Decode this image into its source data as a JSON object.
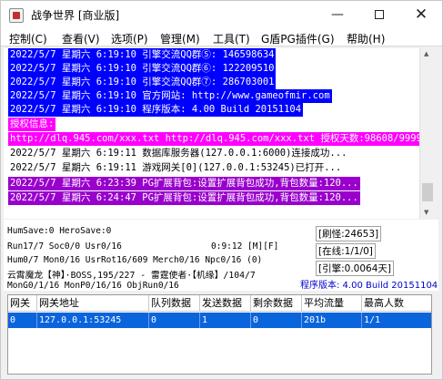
{
  "window": {
    "title": "战争世界 [商业版]",
    "controls": {
      "minimize": "—",
      "close": "✕"
    }
  },
  "menu": [
    "控制(C)",
    "查看(V)",
    "选项(P)",
    "管理(M)",
    "工具(T)",
    "G盾PG插件(G)",
    "帮助(H)"
  ],
  "colors": {
    "blue_bg": "#0000ff",
    "magenta_bg": "#ff00ff",
    "purple_bg": "#9900cc",
    "selected_row": "#0a64dc"
  },
  "log": [
    {
      "text": "2022/5/7 星期六 6:19:10 引擎交流QQ群⑤: 146598634",
      "style": "blue"
    },
    {
      "text": "2022/5/7 星期六 6:19:10 引擎交流QQ群⑥: 122209510",
      "style": "blue"
    },
    {
      "text": "2022/5/7 星期六 6:19:10 引擎交流QQ群⑦: 286703001",
      "style": "blue"
    },
    {
      "text": "2022/5/7 星期六 6:19:10 官方网站: http://www.gameofmir.com",
      "style": "blue"
    },
    {
      "text": "2022/5/7 星期六 6:19:10 程序版本: 4.00 Build 20151104",
      "style": "blue"
    },
    {
      "text": "授权信息:",
      "style": "magenta"
    },
    {
      "text": "http://dlq.945.com/xxx.txt http://dlq.945.com/xxx.txt 授权天数:98608/99999",
      "style": "magenta"
    },
    {
      "text": "2022/5/7 星期六 6:19:11 数据库服务器(127.0.0.1:6000)连接成功...",
      "style": "plain"
    },
    {
      "text": "2022/5/7 星期六 6:19:11 游戏网关[0](127.0.0.1:53245)已打开...",
      "style": "plain"
    },
    {
      "text": "2022/5/7 星期六 6:23:39 PG扩展背包:设置扩展背包成功,背包数量:120...",
      "style": "purple"
    },
    {
      "text": "2022/5/7 星期六 6:24:47 PG扩展背包:设置扩展背包成功,背包数量:120...",
      "style": "purple"
    }
  ],
  "stats": {
    "line1": "HumSave:0 HeroSave:0",
    "line2": "Run17/7 Soc0/0 Usr0/16",
    "time": "0:9:12 [M][F]",
    "line3": "Hum0/7 Mon0/16 UsrRot16/609 Merch0/16 Npc0/16 (0)",
    "line4": "云霄魔龙【神】·BOSS,195/227 - 雷霆使者·【机缘】/104/7",
    "line5": "MonG0/1/16 MonP0/16/16 ObjRun0/16",
    "refresh": "[刷怪:24653]",
    "online": "[在线:1/1/0]",
    "engine": "[引擎:0.0064天]",
    "version": "程序版本: 4.00 Build 20151104"
  },
  "table": {
    "headers": [
      "网关",
      "网关地址",
      "队列数据",
      "发送数据",
      "剩余数据",
      "平均流量",
      "最高人数"
    ],
    "rows": [
      [
        "0",
        "127.0.0.1:53245",
        "0",
        "1",
        "0",
        "201b",
        "1/1"
      ]
    ]
  }
}
